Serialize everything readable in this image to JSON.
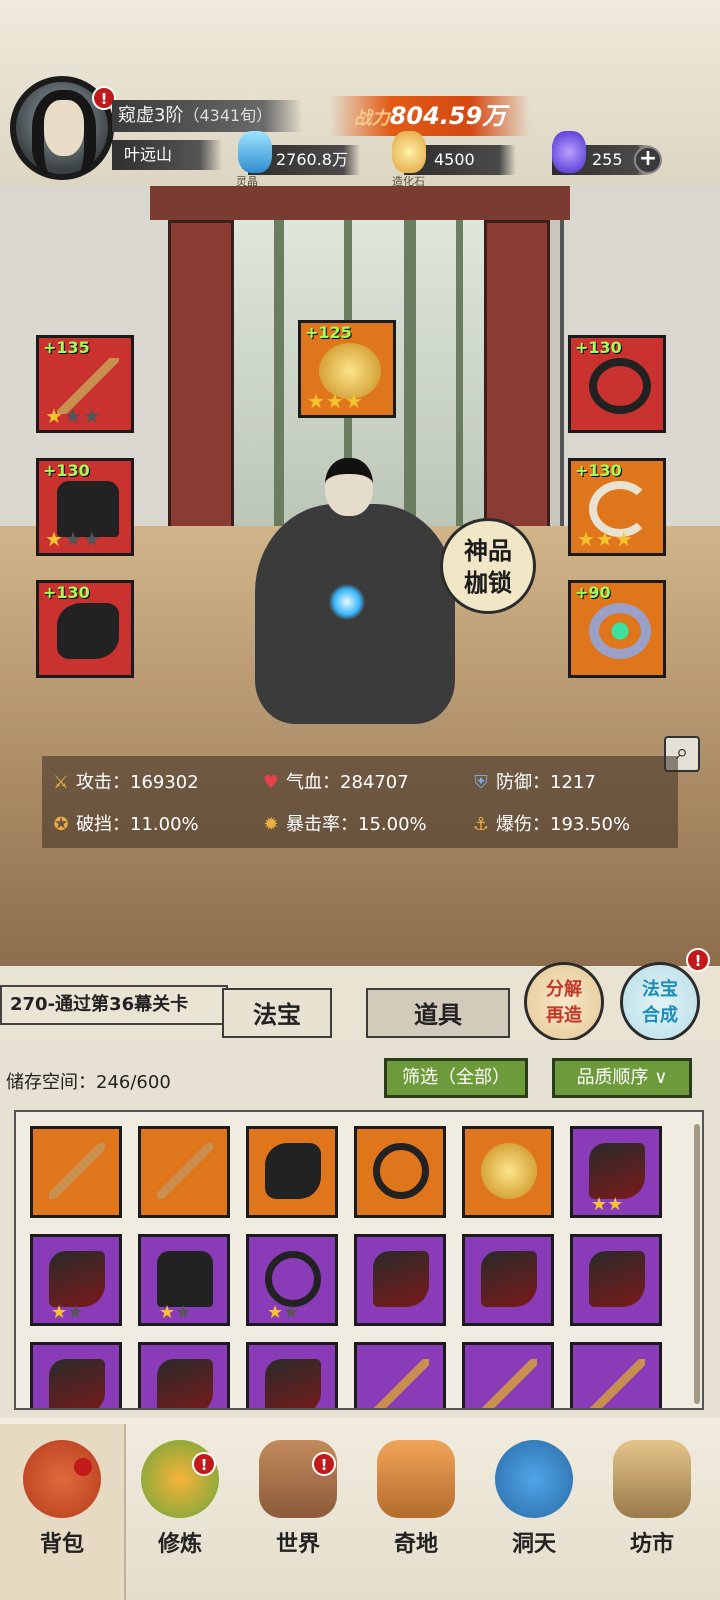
{
  "player": {
    "realm": "窥虚3阶",
    "realm_extra": "（4341旬）",
    "name": "叶远山",
    "combat_power_prefix": "战力",
    "combat_power_value": "804.59万"
  },
  "resources": [
    {
      "icon": "spirit-crystal-icon",
      "label": "灵晶",
      "value": "2760.8万"
    },
    {
      "icon": "creation-stone-icon",
      "label": "造化石",
      "value": "4500"
    },
    {
      "icon": "spirit-flame-icon",
      "label": "",
      "value": "255"
    }
  ],
  "equipment": {
    "left": [
      {
        "name": "weapon",
        "level": "+135",
        "color": "red",
        "stars": 1,
        "max_stars": 3
      },
      {
        "name": "armor",
        "level": "+130",
        "color": "red",
        "stars": 1,
        "max_stars": 3
      },
      {
        "name": "boots",
        "level": "+130",
        "color": "red",
        "stars": 0,
        "max_stars": 0
      }
    ],
    "center": {
      "name": "treasure",
      "level": "+125",
      "color": "orange",
      "stars": 3,
      "max_stars": 3
    },
    "right": [
      {
        "name": "headband",
        "level": "+130",
        "color": "red",
        "stars": 0,
        "max_stars": 0
      },
      {
        "name": "necklace",
        "level": "+130",
        "color": "orange",
        "stars": 3,
        "max_stars": 3
      },
      {
        "name": "ring",
        "level": "+90",
        "color": "orange",
        "stars": 0,
        "max_stars": 0
      }
    ],
    "badge": "神品\n枷锁"
  },
  "stats": [
    {
      "icon": "sword-icon",
      "label": "攻击：",
      "value": "169302"
    },
    {
      "icon": "heart-icon",
      "label": "气血：",
      "value": "284707"
    },
    {
      "icon": "shield-icon",
      "label": "防御：",
      "value": "1217"
    },
    {
      "icon": "break-guard-icon",
      "label": "破挡：",
      "value": "11.00%"
    },
    {
      "icon": "crit-rate-icon",
      "label": "暴击率：",
      "value": "15.00%"
    },
    {
      "icon": "crit-damage-icon",
      "label": "爆伤：",
      "value": "193.50%"
    }
  ],
  "stage": "270-通过第36幕关卡",
  "tabs": [
    "法宝",
    "道具"
  ],
  "actions": {
    "decompose": "分解\n再造",
    "synthesize": "法宝\n合成"
  },
  "inventory": {
    "storage_label": "储存空间：",
    "storage_value": "246/600",
    "filter": "筛选（全部）",
    "sort": "品质顺序"
  },
  "inventory_items": [
    {
      "item": "staff",
      "color": "orange",
      "stars": 0
    },
    {
      "item": "staff",
      "color": "orange",
      "stars": 0
    },
    {
      "item": "boots",
      "color": "orange",
      "stars": 0
    },
    {
      "item": "headband",
      "color": "orange",
      "stars": 0
    },
    {
      "item": "treasure",
      "color": "orange",
      "stars": 0
    },
    {
      "item": "blade",
      "color": "purple",
      "stars": 2
    },
    {
      "item": "blade",
      "color": "purple",
      "stars": 1
    },
    {
      "item": "armor",
      "color": "purple",
      "stars": 1
    },
    {
      "item": "headband",
      "color": "purple",
      "stars": 1
    },
    {
      "item": "blade",
      "color": "purple",
      "stars": 0
    },
    {
      "item": "blade",
      "color": "purple",
      "stars": 0
    },
    {
      "item": "blade",
      "color": "purple",
      "stars": 0
    },
    {
      "item": "blade",
      "color": "purple",
      "stars": 0
    },
    {
      "item": "blade",
      "color": "purple",
      "stars": 0
    },
    {
      "item": "blade",
      "color": "purple",
      "stars": 0
    },
    {
      "item": "staff",
      "color": "purple",
      "stars": 0
    },
    {
      "item": "staff",
      "color": "purple",
      "stars": 0
    },
    {
      "item": "staff",
      "color": "purple",
      "stars": 0
    }
  ],
  "nav": [
    {
      "id": "bag",
      "label": "背包",
      "alert": true
    },
    {
      "id": "cultivate",
      "label": "修炼",
      "alert": true
    },
    {
      "id": "world",
      "label": "世界",
      "alert": true
    },
    {
      "id": "wonder",
      "label": "奇地",
      "alert": false
    },
    {
      "id": "cave",
      "label": "洞天",
      "alert": false
    },
    {
      "id": "market",
      "label": "坊市",
      "alert": false
    }
  ],
  "colors": {
    "red": "#c9322e",
    "orange": "#e0761c",
    "purple": "#8a3cb8",
    "green_button": "#6d9b3b",
    "alert": "#c21a1a"
  }
}
